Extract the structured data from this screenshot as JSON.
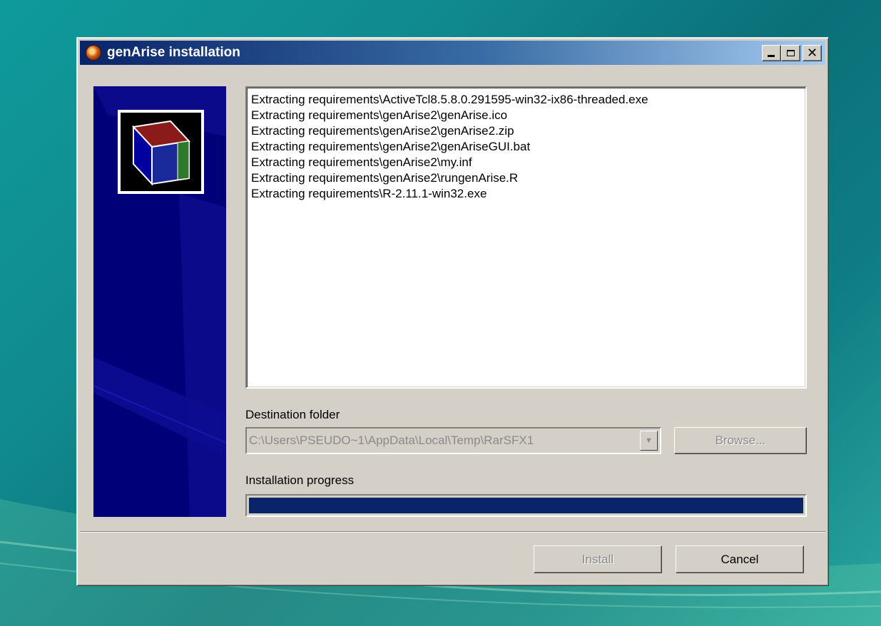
{
  "window": {
    "title": "genArise installation"
  },
  "log_lines": [
    "Extracting requirements\\ActiveTcl8.5.8.0.291595-win32-ix86-threaded.exe",
    "Extracting requirements\\genArise2\\genArise.ico",
    "Extracting requirements\\genArise2\\genArise2.zip",
    "Extracting requirements\\genArise2\\genAriseGUI.bat",
    "Extracting requirements\\genArise2\\my.inf",
    "Extracting requirements\\genArise2\\rungenArise.R",
    "Extracting requirements\\R-2.11.1-win32.exe"
  ],
  "destination": {
    "label": "Destination folder",
    "value": "C:\\Users\\PSEUDO~1\\AppData\\Local\\Temp\\RarSFX1",
    "browse_label": "Browse..."
  },
  "progress": {
    "label": "Installation progress",
    "percent": 100
  },
  "buttons": {
    "install": "Install",
    "cancel": "Cancel"
  },
  "colors": {
    "banner": "#000078",
    "progress_fill": "#0a246a",
    "title_gradient_start": "#0a246a",
    "title_gradient_end": "#a6caf0"
  },
  "icons": {
    "app": "genarise-app-icon",
    "logo": "box-logo-icon"
  }
}
